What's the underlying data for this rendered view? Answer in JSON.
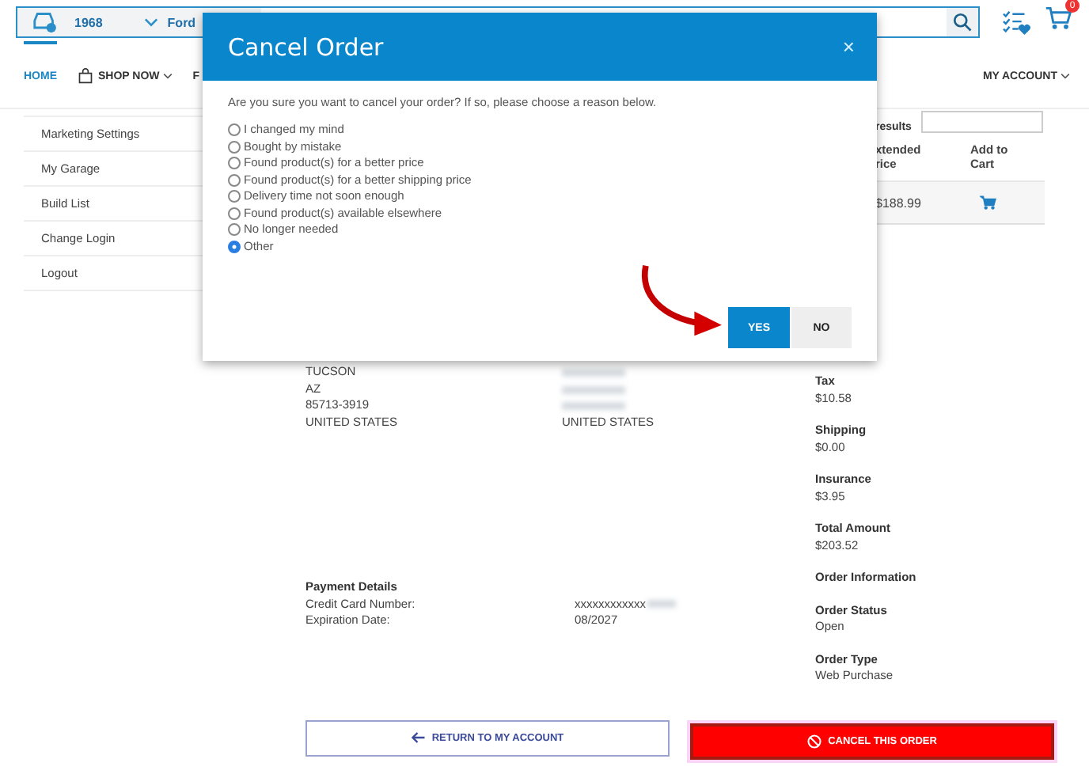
{
  "top_bar": {
    "vehicle_year": "1968",
    "vehicle_make": "Ford",
    "cart_count": "0"
  },
  "nav": [
    {
      "label": "HOME",
      "selected": true,
      "kind": "plain"
    },
    {
      "label": "SHOP NOW",
      "selected": false,
      "kind": "dropdown"
    },
    {
      "label": "F",
      "selected": false,
      "kind": "plain"
    }
  ],
  "account_menu": "MY ACCOUNT",
  "sidebar": {
    "items": [
      {
        "label": "Marketing Settings"
      },
      {
        "label": "My Garage"
      },
      {
        "label": "Build List"
      },
      {
        "label": "Change Login"
      },
      {
        "label": "Logout"
      }
    ]
  },
  "results_label": "results",
  "table": {
    "columns": [
      "xtended\nrice",
      "Add to\nCart"
    ],
    "rows": [
      {
        "extended_price": "$188.99"
      }
    ]
  },
  "address_column": [
    "TUCSON",
    "AZ",
    "85713-3919",
    "UNITED STATES"
  ],
  "address_column_2": [
    {
      "kind": "redacted"
    },
    {
      "kind": "redacted"
    },
    {
      "kind": "redacted"
    },
    {
      "kind": "text",
      "text": "UNITED STATES"
    }
  ],
  "payment": {
    "title": "Payment Details",
    "rows": [
      {
        "label": "Credit Card Number:",
        "value": "xxxxxxxxxxxx",
        "redacted_suffix": true
      },
      {
        "label": "Expiration Date:",
        "value": "08/2027",
        "redacted_suffix": false
      }
    ]
  },
  "summary": [
    {
      "label": "Tax",
      "value": "$10.58"
    },
    {
      "label": "Shipping",
      "value": "$0.00"
    },
    {
      "label": "Insurance",
      "value": "$3.95"
    },
    {
      "label": "Total Amount",
      "value": "$203.52"
    },
    {
      "label": "Order Information"
    },
    {
      "label": "Order Status",
      "value": "Open"
    },
    {
      "label": "Order Type",
      "value": "Web Purchase"
    }
  ],
  "buttons": {
    "return": "RETURN TO MY ACCOUNT",
    "cancel": "CANCEL THIS ORDER"
  },
  "modal": {
    "title": "Cancel Order",
    "close": "×",
    "question": "Are you sure you want to cancel your order? If so, please choose a reason below.",
    "reasons": [
      {
        "label": "I changed my mind",
        "selected": false
      },
      {
        "label": "Bought by mistake",
        "selected": false
      },
      {
        "label": "Found product(s) for a better price",
        "selected": false
      },
      {
        "label": "Found product(s) for a better shipping price",
        "selected": false
      },
      {
        "label": "Delivery time not soon enough",
        "selected": false
      },
      {
        "label": "Found product(s) available elsewhere",
        "selected": false
      },
      {
        "label": "No longer needed",
        "selected": false
      },
      {
        "label": "Other",
        "selected": true
      }
    ],
    "yes": "YES",
    "no": "NO"
  }
}
